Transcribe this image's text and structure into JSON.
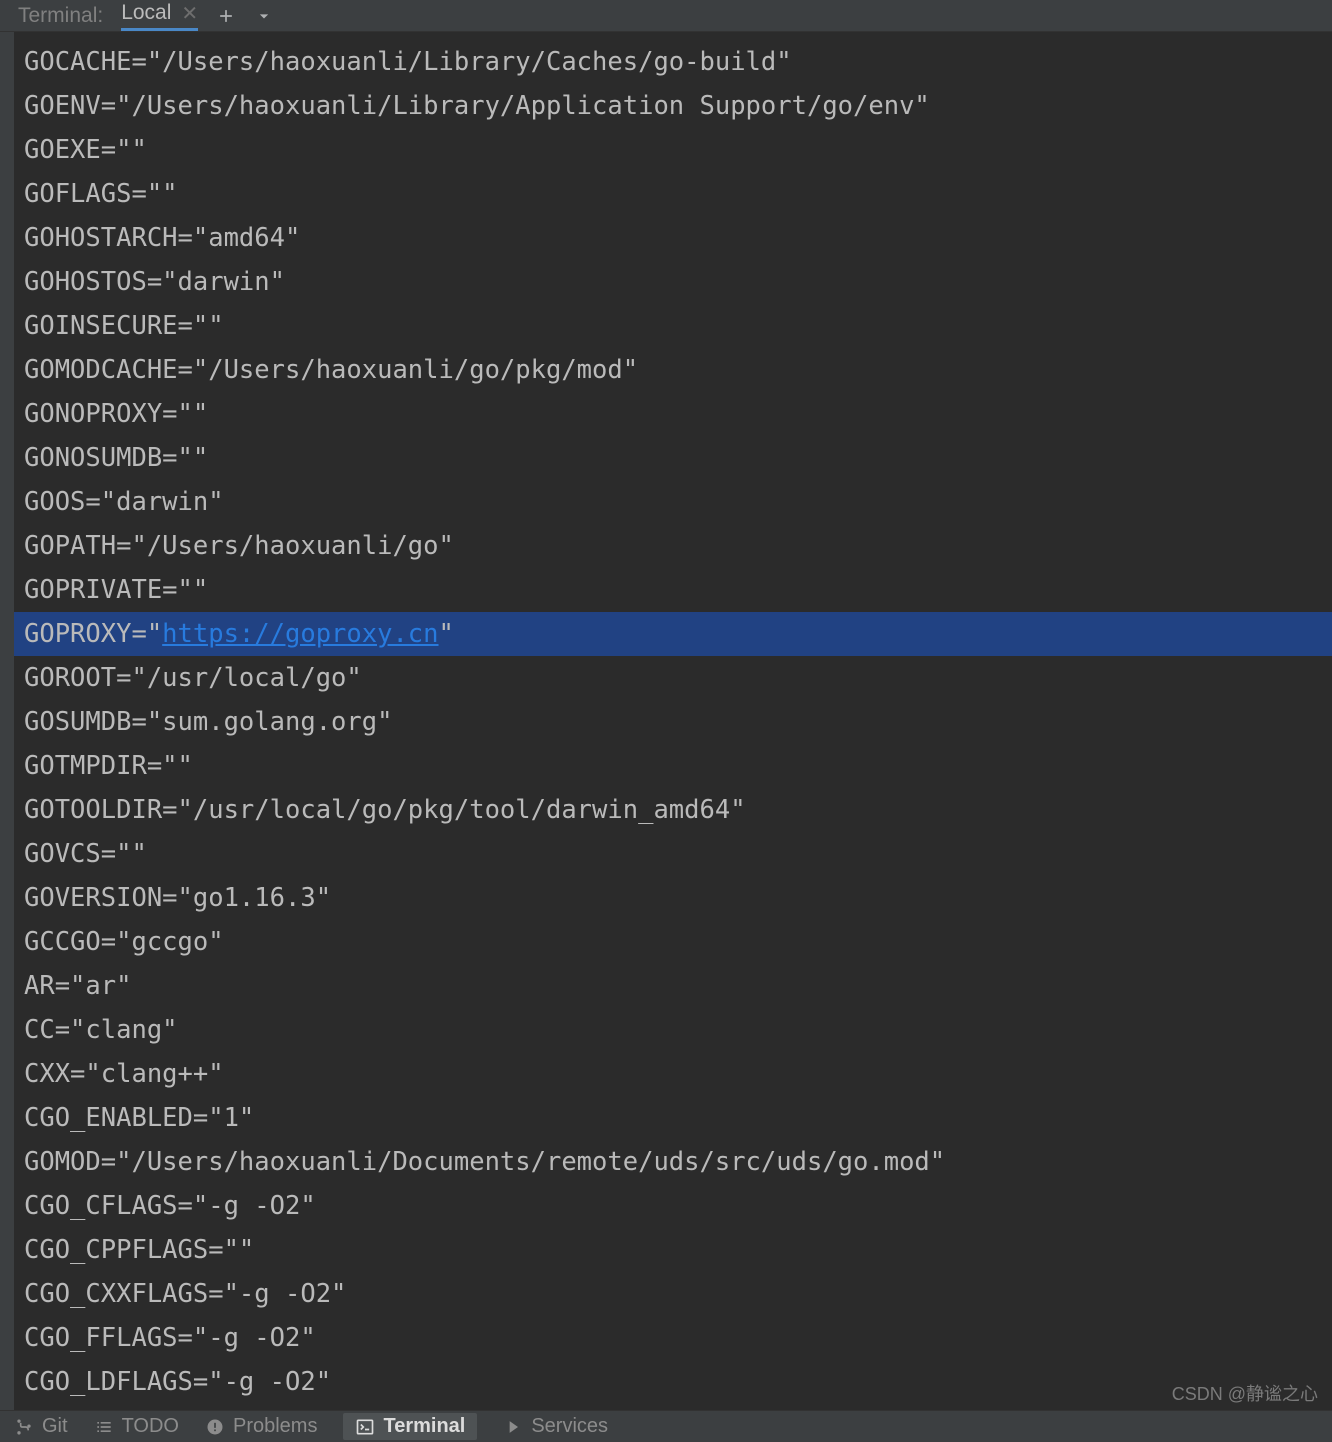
{
  "header": {
    "label": "Terminal:",
    "tab": {
      "name": "Local"
    }
  },
  "terminal": {
    "lines": [
      {
        "text": "GOCACHE=\"/Users/haoxuanli/Library/Caches/go-build\"",
        "highlighted": false
      },
      {
        "text": "GOENV=\"/Users/haoxuanli/Library/Application Support/go/env\"",
        "highlighted": false
      },
      {
        "text": "GOEXE=\"\"",
        "highlighted": false
      },
      {
        "text": "GOFLAGS=\"\"",
        "highlighted": false
      },
      {
        "text": "GOHOSTARCH=\"amd64\"",
        "highlighted": false
      },
      {
        "text": "GOHOSTOS=\"darwin\"",
        "highlighted": false
      },
      {
        "text": "GOINSECURE=\"\"",
        "highlighted": false
      },
      {
        "text": "GOMODCACHE=\"/Users/haoxuanli/go/pkg/mod\"",
        "highlighted": false
      },
      {
        "text": "GONOPROXY=\"\"",
        "highlighted": false
      },
      {
        "text": "GONOSUMDB=\"\"",
        "highlighted": false
      },
      {
        "text": "GOOS=\"darwin\"",
        "highlighted": false
      },
      {
        "text": "GOPATH=\"/Users/haoxuanli/go\"",
        "highlighted": false
      },
      {
        "text": "GOPRIVATE=\"\"",
        "highlighted": false
      },
      {
        "prefix": "GOPROXY=\"",
        "link": "https://goproxy.cn",
        "suffix": "\"",
        "highlighted": true
      },
      {
        "text": "GOROOT=\"/usr/local/go\"",
        "highlighted": false
      },
      {
        "text": "GOSUMDB=\"sum.golang.org\"",
        "highlighted": false
      },
      {
        "text": "GOTMPDIR=\"\"",
        "highlighted": false
      },
      {
        "text": "GOTOOLDIR=\"/usr/local/go/pkg/tool/darwin_amd64\"",
        "highlighted": false
      },
      {
        "text": "GOVCS=\"\"",
        "highlighted": false
      },
      {
        "text": "GOVERSION=\"go1.16.3\"",
        "highlighted": false
      },
      {
        "text": "GCCGO=\"gccgo\"",
        "highlighted": false
      },
      {
        "text": "AR=\"ar\"",
        "highlighted": false
      },
      {
        "text": "CC=\"clang\"",
        "highlighted": false
      },
      {
        "text": "CXX=\"clang++\"",
        "highlighted": false
      },
      {
        "text": "CGO_ENABLED=\"1\"",
        "highlighted": false
      },
      {
        "text": "GOMOD=\"/Users/haoxuanli/Documents/remote/uds/src/uds/go.mod\"",
        "highlighted": false
      },
      {
        "text": "CGO_CFLAGS=\"-g -O2\"",
        "highlighted": false
      },
      {
        "text": "CGO_CPPFLAGS=\"\"",
        "highlighted": false
      },
      {
        "text": "CGO_CXXFLAGS=\"-g -O2\"",
        "highlighted": false
      },
      {
        "text": "CGO_FFLAGS=\"-g -O2\"",
        "highlighted": false
      },
      {
        "text": "CGO_LDFLAGS=\"-g -O2\"",
        "highlighted": false
      }
    ]
  },
  "bottom": {
    "git": "Git",
    "todo": "TODO",
    "problems": "Problems",
    "terminal": "Terminal",
    "services": "Services"
  },
  "watermark": "CSDN @静谧之心"
}
